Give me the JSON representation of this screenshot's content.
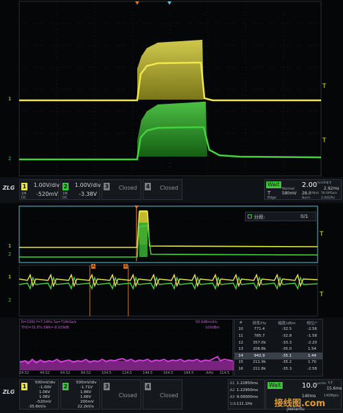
{
  "colors": {
    "ch1": "#e9e14a",
    "ch2": "#3ec63a",
    "math": "#d83ce0",
    "accent": "#4fc6e0",
    "orange": "#e07a27"
  },
  "top_scope": {
    "marker_ch1": "1",
    "marker_ch2": "2",
    "trigger_marker": "T"
  },
  "ch1": {
    "num": "1",
    "volts_div": "1.00V/div",
    "offset": "-520mV",
    "tag": "1M",
    "tag2": "DC"
  },
  "ch2": {
    "num": "2",
    "volts_div": "1.00V/div",
    "offset": "-3.38V",
    "tag": "1M",
    "tag2": "DC"
  },
  "ch3": {
    "num": "3",
    "state": "Closed"
  },
  "ch4": {
    "num": "4",
    "state": "Closed"
  },
  "status": {
    "run": "Wait",
    "t_label": "T",
    "timebase": "2.00",
    "timebase_unit": "ms/div",
    "t_offset": "T-T",
    "t_offset_val": "2.92ms",
    "sample": "28.0",
    "sample_unit": "Mpts",
    "rate": "56.0MSa/s",
    "normal": "Normal",
    "trig_level": "580mV",
    "edge": "Edge",
    "norm2": "Norm",
    "pts": "2.00GPts"
  },
  "segment": {
    "label": "分段:",
    "value": "0/1"
  },
  "cursors": {
    "a": "A",
    "b": "B"
  },
  "fft_info": {
    "line1": "N=100k  f=7.14Hz  Sa=714kSa/s",
    "line2": "THD=31.8%  SNR=-8.029dB",
    "db": "50.0dBm/div",
    "ref": "100dBm"
  },
  "fft_axis": [
    "24.52",
    "44.52",
    "64.52",
    "84.52",
    "104.5",
    "124.5",
    "144.5",
    "164.5",
    "184.5",
    "/kHz",
    "214.5"
  ],
  "harmonics": {
    "headers": [
      "#",
      "频率/Hz",
      "幅度/dBm",
      "相位/°"
    ],
    "rows": [
      [
        "10",
        "771.4",
        "-32.5",
        "-2.56"
      ],
      [
        "11",
        "785.7",
        "-32.8",
        "-1.58"
      ],
      [
        "12",
        "357.0k",
        "-33.3",
        "-2.20"
      ],
      [
        "13",
        "206.8k",
        "-35.0",
        "1.54"
      ],
      [
        "14",
        "942.9",
        "-35.1",
        "1.44"
      ],
      [
        "15",
        "211.9k",
        "-35.2",
        "1.70"
      ],
      [
        "16",
        "211.8k",
        "-35.3",
        "-2.58"
      ]
    ],
    "highlight_index": 4
  },
  "bottom": {
    "ch1": {
      "num": "1",
      "v1": "500mV/div",
      "v2": "-1.00V",
      "r1": "1.06V",
      "r2": "1.06V",
      "r3": "-520mV",
      "r4": "-35.6kV/s"
    },
    "ch2": {
      "num": "2",
      "v1": "500mV/div",
      "v2": "-1.71V",
      "r1": "1.86V",
      "r2": "1.66V",
      "r3": "200mV",
      "r4": "22.2kV/s"
    },
    "ch3": {
      "num": "3",
      "state": "Closed"
    },
    "ch4": {
      "num": "4",
      "state": "Closed"
    },
    "cursor": {
      "l1": "Δ1",
      "v1": "1.22850ms",
      "l2": "Δ2",
      "v2": "1.22950ms",
      "l3": "ΔX",
      "v3": "9.00000ms",
      "l4": "1/Δ",
      "v4": "111.1Hz"
    },
    "status": {
      "run": "Wait",
      "timebase": "10.0",
      "unit": "μs/div",
      "t": "T-T",
      "tv": "15.6ms",
      "rate": "140ms",
      "pts": "140Mpts"
    }
  },
  "watermark": {
    "site": "接线图.com",
    "sub": "jiexiantu"
  }
}
